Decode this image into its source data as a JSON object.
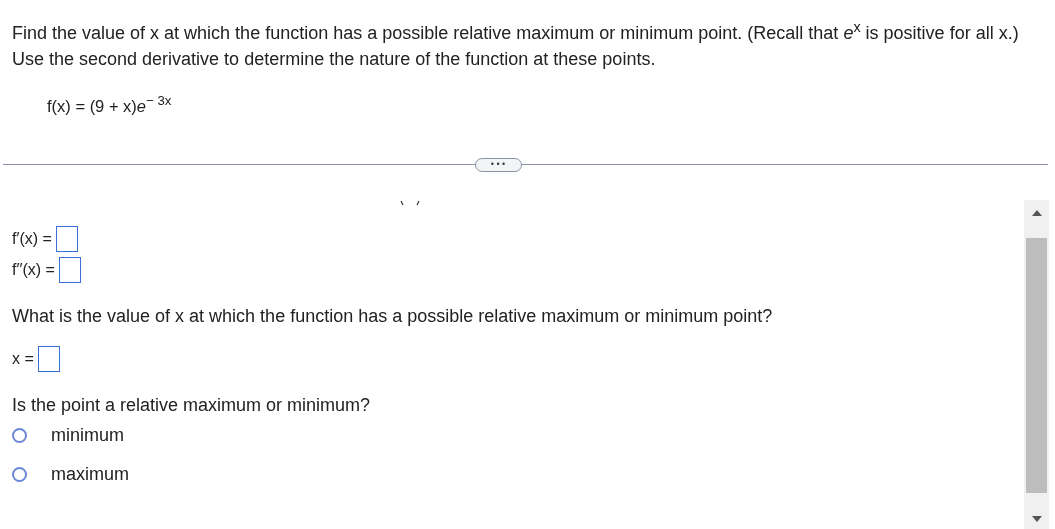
{
  "question": {
    "prompt": "Find the value of x at which the function has a possible relative maximum or minimum point. (Recall that *e*$^{x}$ is positive for all x.) Use the second derivative to determine the nature of the function at these points.",
    "formula": "f(x) = (9 + x)*e*$^{− 3x}$"
  },
  "expand_button": {
    "label": "•••"
  },
  "answers": [
    {
      "label": "f′(x) ="
    },
    {
      "label": "f′′(x) ="
    }
  ],
  "critical_point": {
    "question": "What is the value of x at which the function has a possible relative maximum or minimum point?",
    "label": "x ="
  },
  "classification": {
    "question": "Is the point a relative maximum or minimum?",
    "options": [
      {
        "label": "minimum",
        "selected": false
      },
      {
        "label": "maximum",
        "selected": false
      }
    ]
  }
}
